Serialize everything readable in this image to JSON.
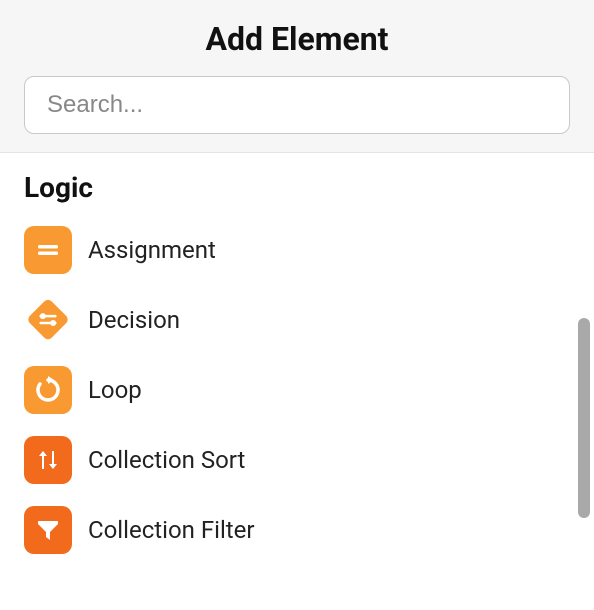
{
  "header": {
    "title": "Add Element",
    "search_placeholder": "Search..."
  },
  "section": {
    "heading": "Logic",
    "items": [
      {
        "label": "Assignment",
        "icon": "assignment-icon"
      },
      {
        "label": "Decision",
        "icon": "decision-icon"
      },
      {
        "label": "Loop",
        "icon": "loop-icon"
      },
      {
        "label": "Collection Sort",
        "icon": "collection-sort-icon"
      },
      {
        "label": "Collection Filter",
        "icon": "collection-filter-icon"
      }
    ]
  },
  "colors": {
    "icon_light_orange": "#f99932",
    "icon_dark_orange": "#f26b1d"
  }
}
